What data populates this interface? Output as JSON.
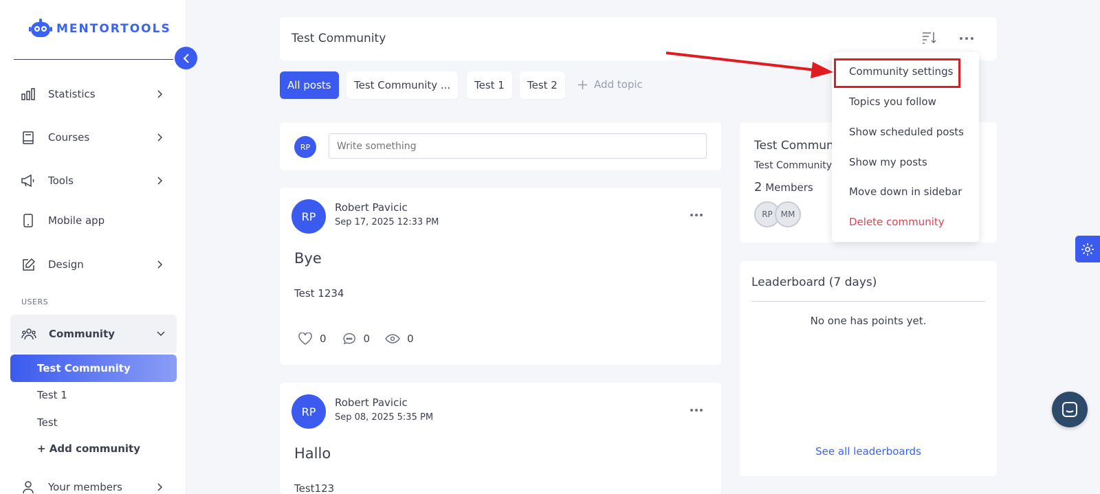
{
  "brand": {
    "name": "MENTORTOOLS",
    "color": "#3a63f0"
  },
  "sidebar": {
    "items": [
      {
        "label": "Statistics",
        "icon": "bar-chart-icon"
      },
      {
        "label": "Courses",
        "icon": "book-icon"
      },
      {
        "label": "Tools",
        "icon": "megaphone-icon"
      },
      {
        "label": "Mobile app",
        "icon": "phone-icon"
      },
      {
        "label": "Design",
        "icon": "edit-icon"
      }
    ],
    "section_users": "USERS",
    "community": {
      "label": "Community",
      "icon": "users-icon"
    },
    "communities": [
      "Test Community",
      "Test 1",
      "Test"
    ],
    "add_community": "+ Add community",
    "your_members": {
      "label": "Your members",
      "icon": "user-icon"
    }
  },
  "header": {
    "title": "Test Community"
  },
  "tabs": [
    {
      "label": "All posts",
      "active": true
    },
    {
      "label": "Test Community ..."
    },
    {
      "label": "Test 1"
    },
    {
      "label": "Test 2"
    }
  ],
  "add_topic": "Add topic",
  "composer": {
    "avatar": "RP",
    "placeholder": "Write something"
  },
  "posts": [
    {
      "avatar": "RP",
      "author": "Robert Pavicic",
      "date": "Sep 17, 2025 12:33 PM",
      "title": "Bye",
      "body": "Test 1234",
      "likes": "0",
      "comments": "0",
      "views": "0"
    },
    {
      "avatar": "RP",
      "author": "Robert Pavicic",
      "date": "Sep 08, 2025 5:35 PM",
      "title": "Hallo",
      "body": "Test123"
    }
  ],
  "info_card": {
    "title": "Test Commun",
    "subtitle": "Test Community",
    "member_count": "2",
    "members_label": "Members",
    "avatars": [
      "RP",
      "MM"
    ]
  },
  "leaderboard": {
    "title": "Leaderboard (7 days)",
    "empty": "No one has points yet.",
    "link": "See all leaderboards"
  },
  "dropdown": {
    "items": [
      "Community settings",
      "Topics you follow",
      "Show scheduled posts",
      "Show my posts",
      "Move down in sidebar"
    ],
    "danger": "Delete community"
  },
  "colors": {
    "accent": "#3b5bf0",
    "danger": "#e0414f",
    "annotation": "#e01b22"
  }
}
